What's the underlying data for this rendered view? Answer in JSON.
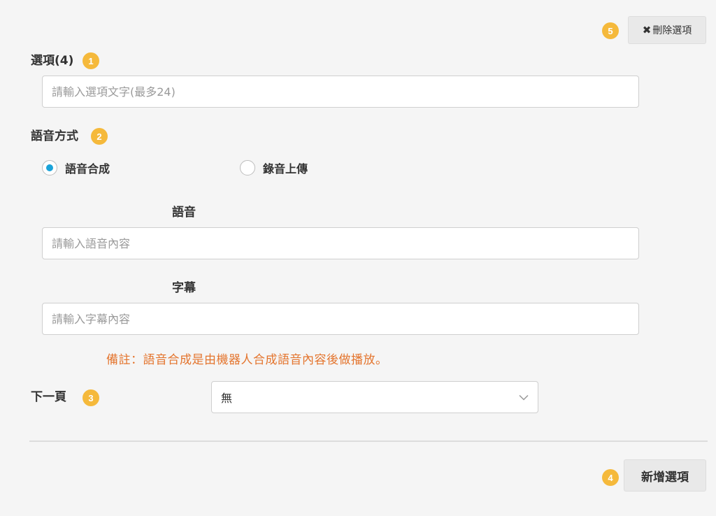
{
  "header": {
    "delete_badge": "5",
    "delete_icon": "close-icon",
    "delete_label": "刪除選項"
  },
  "option": {
    "label": "選項(4)",
    "badge": "1",
    "placeholder": "請輸入選項文字(最多24)",
    "value": ""
  },
  "voice_mode": {
    "label": "語音方式",
    "badge": "2",
    "options": [
      {
        "label": "語音合成",
        "checked": true
      },
      {
        "label": "錄音上傳",
        "checked": false
      }
    ]
  },
  "speech": {
    "label": "語音",
    "placeholder": "請輸入語音內容",
    "value": ""
  },
  "subtitle": {
    "label": "字幕",
    "placeholder": "請輸入字幕內容",
    "value": ""
  },
  "note": "備註：語音合成是由機器人合成語音內容後做播放。",
  "next_page": {
    "label": "下一頁",
    "badge": "3",
    "selected": "無",
    "chevron": "chevron-down-icon"
  },
  "footer": {
    "add_badge": "4",
    "add_label": "新增選項"
  },
  "colors": {
    "badge": "#f5b93b",
    "radio_checked": "#1aa3d9",
    "note": "#e4752e",
    "background": "#f5f5f5"
  }
}
